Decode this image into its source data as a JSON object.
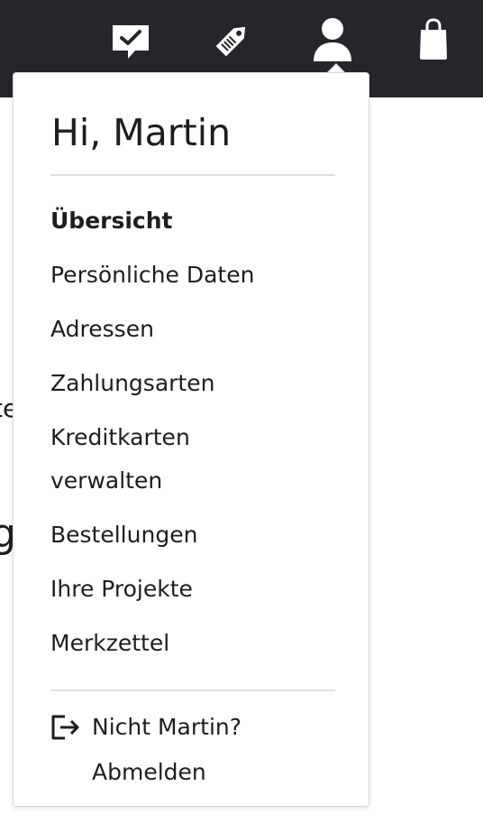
{
  "header": {
    "icons": [
      "messages-check-icon",
      "tag-icon",
      "user-icon",
      "shopping-bag-icon"
    ],
    "background": "#24262b"
  },
  "background_fragments": {
    "fragment_1": "te",
    "fragment_2": "g"
  },
  "account_menu": {
    "greeting": "Hi, Martin",
    "items": [
      {
        "label": "Übersicht",
        "active": true
      },
      {
        "label": "Persönliche Daten",
        "active": false
      },
      {
        "label": "Adressen",
        "active": false
      },
      {
        "label": "Zahlungsarten",
        "active": false
      },
      {
        "label": "Kreditkarten verwalten",
        "active": false
      },
      {
        "label": "Bestellungen",
        "active": false
      },
      {
        "label": "Ihre Projekte",
        "active": false
      },
      {
        "label": "Merkzettel",
        "active": false
      }
    ],
    "logout_label": "Nicht Martin? Abmelden"
  }
}
